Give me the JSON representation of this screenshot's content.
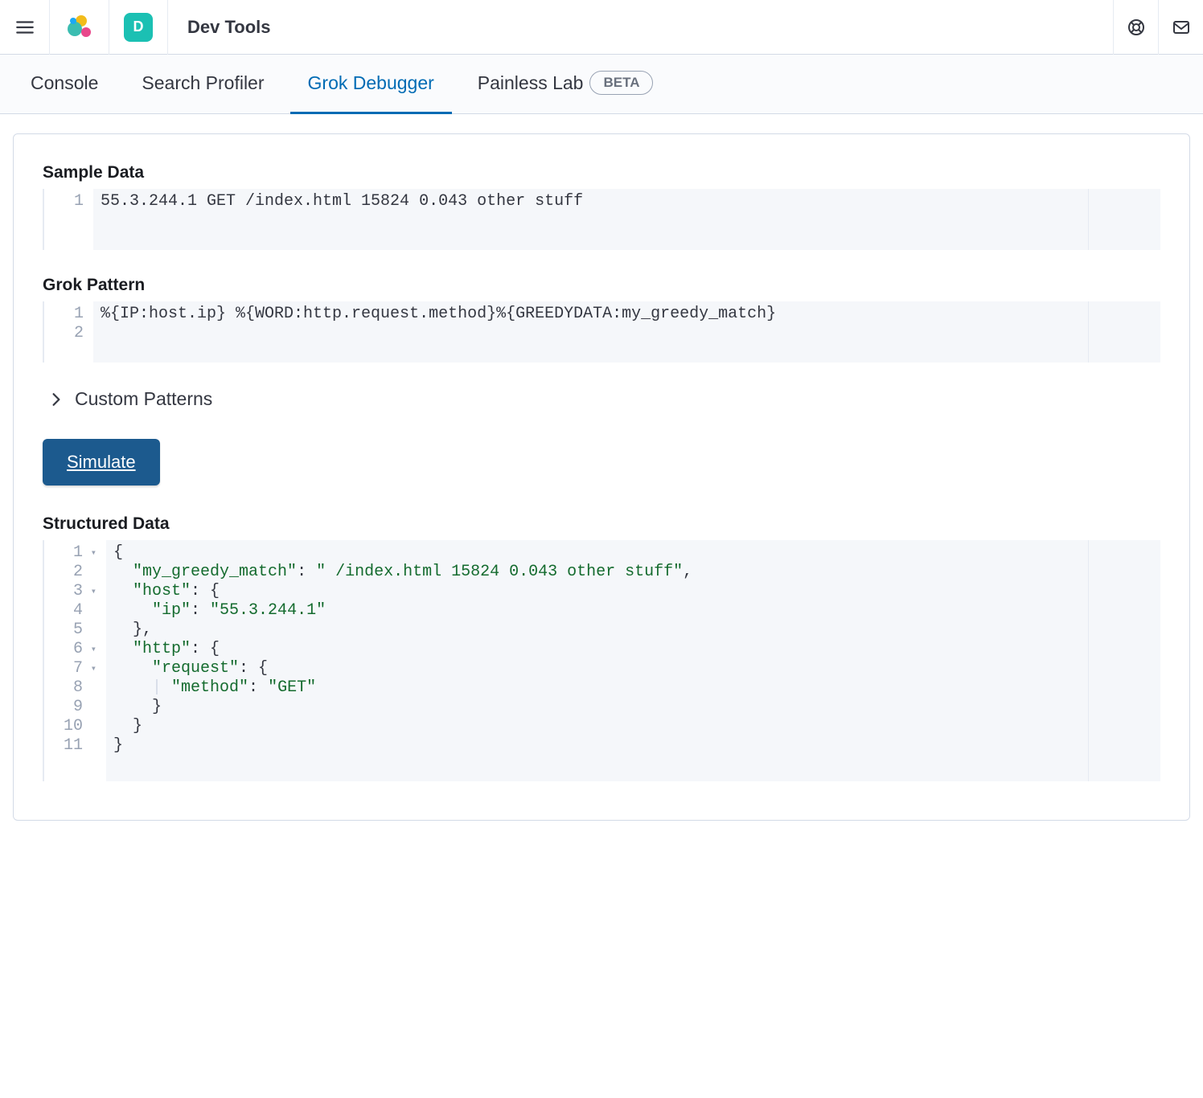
{
  "header": {
    "space_initial": "D",
    "breadcrumb": "Dev Tools"
  },
  "tabs": [
    {
      "label": "Console",
      "active": false
    },
    {
      "label": "Search Profiler",
      "active": false
    },
    {
      "label": "Grok Debugger",
      "active": true
    },
    {
      "label": "Painless Lab",
      "active": false,
      "badge": "BETA"
    }
  ],
  "labels": {
    "sample_data": "Sample Data",
    "grok_pattern": "Grok Pattern",
    "custom_patterns": "Custom Patterns",
    "simulate": "Simulate",
    "structured_data": "Structured Data"
  },
  "sample_data": {
    "lines": [
      "55.3.244.1 GET /index.html 15824 0.043 other stuff"
    ]
  },
  "grok_pattern": {
    "lines": [
      "%{IP:host.ip} %{WORD:http.request.method}%{GREEDYDATA:my_greedy_match}",
      ""
    ]
  },
  "structured_data": {
    "pretty_lines": [
      {
        "n": 1,
        "fold": true,
        "indent": 0,
        "tokens": [
          {
            "t": "punc",
            "v": "{"
          }
        ]
      },
      {
        "n": 2,
        "fold": false,
        "indent": 1,
        "tokens": [
          {
            "t": "key",
            "v": "\"my_greedy_match\""
          },
          {
            "t": "punc",
            "v": ": "
          },
          {
            "t": "str",
            "v": "\" /index.html 15824 0.043 other stuff\""
          },
          {
            "t": "punc",
            "v": ","
          }
        ]
      },
      {
        "n": 3,
        "fold": true,
        "indent": 1,
        "tokens": [
          {
            "t": "key",
            "v": "\"host\""
          },
          {
            "t": "punc",
            "v": ": {"
          }
        ]
      },
      {
        "n": 4,
        "fold": false,
        "indent": 2,
        "tokens": [
          {
            "t": "key",
            "v": "\"ip\""
          },
          {
            "t": "punc",
            "v": ": "
          },
          {
            "t": "str",
            "v": "\"55.3.244.1\""
          }
        ]
      },
      {
        "n": 5,
        "fold": false,
        "indent": 1,
        "tokens": [
          {
            "t": "punc",
            "v": "},"
          }
        ]
      },
      {
        "n": 6,
        "fold": true,
        "indent": 1,
        "tokens": [
          {
            "t": "key",
            "v": "\"http\""
          },
          {
            "t": "punc",
            "v": ": {"
          }
        ]
      },
      {
        "n": 7,
        "fold": true,
        "indent": 2,
        "tokens": [
          {
            "t": "key",
            "v": "\"request\""
          },
          {
            "t": "punc",
            "v": ": {"
          }
        ]
      },
      {
        "n": 8,
        "fold": false,
        "indent": 3,
        "guide": true,
        "tokens": [
          {
            "t": "key",
            "v": "\"method\""
          },
          {
            "t": "punc",
            "v": ": "
          },
          {
            "t": "str",
            "v": "\"GET\""
          }
        ]
      },
      {
        "n": 9,
        "fold": false,
        "indent": 2,
        "tokens": [
          {
            "t": "punc",
            "v": "}"
          }
        ]
      },
      {
        "n": 10,
        "fold": false,
        "indent": 1,
        "tokens": [
          {
            "t": "punc",
            "v": "}"
          }
        ]
      },
      {
        "n": 11,
        "fold": false,
        "indent": 0,
        "tokens": [
          {
            "t": "punc",
            "v": "}"
          }
        ]
      }
    ]
  }
}
